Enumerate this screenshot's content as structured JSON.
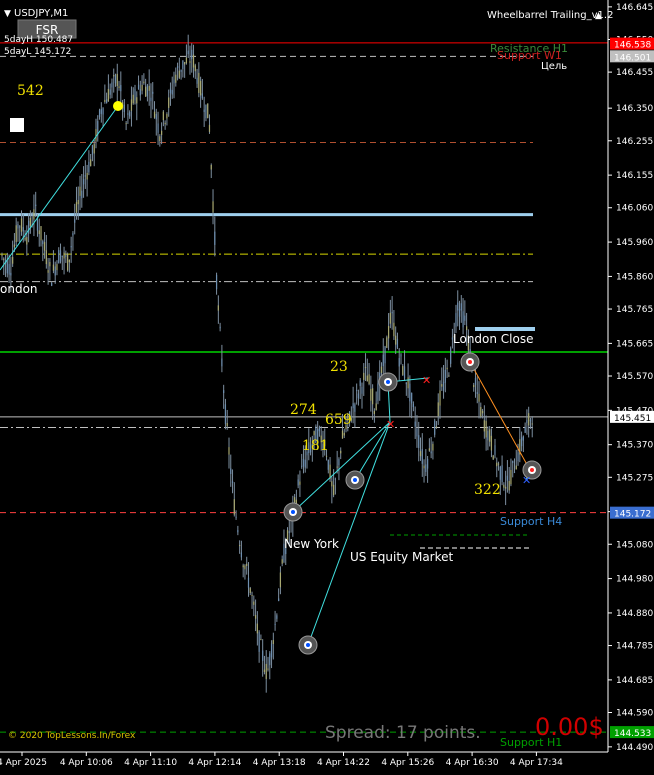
{
  "window": {
    "symbol_title": "USDJPY,M1",
    "fsr_button": "FSR",
    "indicator_title": "Wheelbarrel Trailing_v1.2",
    "five_day_high": "5dayH 150.487",
    "five_day_low": "5dayL 145.172",
    "copyright": "© 2020 TopLessons.In/Forex",
    "spread_text": "Spread: 17 points.",
    "profit_text": "0.00$"
  },
  "colors": {
    "background": "#000000",
    "candles": "#8899aa",
    "price_axis_text": "#ffffff",
    "resistance": "#ff0000",
    "light_blue_level": "#9ecfee",
    "green_level": "#00a000",
    "yellow_level": "#d8d800",
    "annotation_yellow": "#f0e000",
    "profit_red": "#d00000"
  },
  "session_labels": {
    "london": "ondon",
    "london_close": "London Close",
    "new_york": "New York",
    "us_equity": "US Equity Market"
  },
  "level_labels": {
    "resistance_h1": "Resistance H1",
    "support_w1": "Support W1",
    "target": "Цель",
    "support_h4": "Support H4",
    "support_h1": "Support H1"
  },
  "pip_labels": [
    "542",
    "23",
    "274",
    "659",
    "181",
    "322"
  ],
  "chart_data": {
    "type": "candlestick",
    "symbol": "USDJPY",
    "timeframe": "M1",
    "y_ticks": [
      "146.645",
      "146.550",
      "146.455",
      "146.350",
      "146.255",
      "146.155",
      "146.060",
      "145.960",
      "145.860",
      "145.765",
      "145.665",
      "145.570",
      "145.470",
      "145.370",
      "145.275",
      "145.175",
      "145.080",
      "144.980",
      "144.880",
      "144.785",
      "144.685",
      "144.590",
      "144.490"
    ],
    "x_ticks": [
      "4 Apr 2025",
      "4 Apr 10:06",
      "4 Apr 11:10",
      "4 Apr 12:14",
      "4 Apr 13:18",
      "4 Apr 14:22",
      "4 Apr 15:26",
      "4 Apr 16:30",
      "4 Apr 17:34"
    ],
    "ylim": [
      144.475,
      146.665
    ],
    "price_tags": [
      {
        "value": "146.538",
        "color": "#ff0000"
      },
      {
        "value": "146.501",
        "color": "#c0c0c0"
      },
      {
        "value": "145.451",
        "color": "#ffffff"
      },
      {
        "value": "145.172",
        "color": "#3a6ed0"
      },
      {
        "value": "144.533",
        "color": "#00a000"
      }
    ],
    "levels": [
      {
        "name": "Resistance H1",
        "price": 146.54,
        "color": "#ff0000",
        "style": "solid"
      },
      {
        "name": "Target",
        "price": 146.501,
        "color": "#c0c0c0",
        "style": "dashed"
      },
      {
        "name": "Level",
        "price": 146.25,
        "color": "#b05030",
        "style": "dashed"
      },
      {
        "name": "Light Blue",
        "price": 146.04,
        "color": "#9ecfee",
        "style": "solid"
      },
      {
        "name": "Yellow",
        "price": 145.925,
        "color": "#d8d800",
        "style": "dashdot"
      },
      {
        "name": "Grey",
        "price": 145.845,
        "color": "#c0c0c0",
        "style": "dashdot"
      },
      {
        "name": "Green",
        "price": 145.64,
        "color": "#00a000",
        "style": "solid"
      },
      {
        "name": "Current",
        "price": 145.451,
        "color": "#c0c0c0",
        "style": "solid"
      },
      {
        "name": "Grey 2",
        "price": 145.42,
        "color": "#c0c0c0",
        "style": "dashdot"
      },
      {
        "name": "Support H4",
        "price": 145.172,
        "color": "#ff4040",
        "style": "dashed"
      },
      {
        "name": "Support H1",
        "price": 144.533,
        "color": "#00a000",
        "style": "dashed"
      }
    ],
    "price_path": [
      145.92,
      145.88,
      146.02,
      145.98,
      146.05,
      145.95,
      145.86,
      145.93,
      145.9,
      146.05,
      146.15,
      146.22,
      146.35,
      146.4,
      146.44,
      146.3,
      146.38,
      146.42,
      146.4,
      146.28,
      146.35,
      146.45,
      146.48,
      146.5,
      146.4,
      146.32,
      145.8,
      145.45,
      145.2,
      145.05,
      144.95,
      144.8,
      144.7,
      144.85,
      145.05,
      145.15,
      145.28,
      145.35,
      145.4,
      145.38,
      145.22,
      145.38,
      145.45,
      145.52,
      145.58,
      145.48,
      145.6,
      145.75,
      145.62,
      145.55,
      145.42,
      145.3,
      145.38,
      145.52,
      145.6,
      145.78,
      145.72,
      145.55,
      145.45,
      145.38,
      145.3,
      145.25,
      145.32,
      145.4,
      145.46
    ],
    "x_range": [
      0,
      607
    ],
    "series": [
      {
        "name": "",
        "type": "candles"
      }
    ]
  }
}
